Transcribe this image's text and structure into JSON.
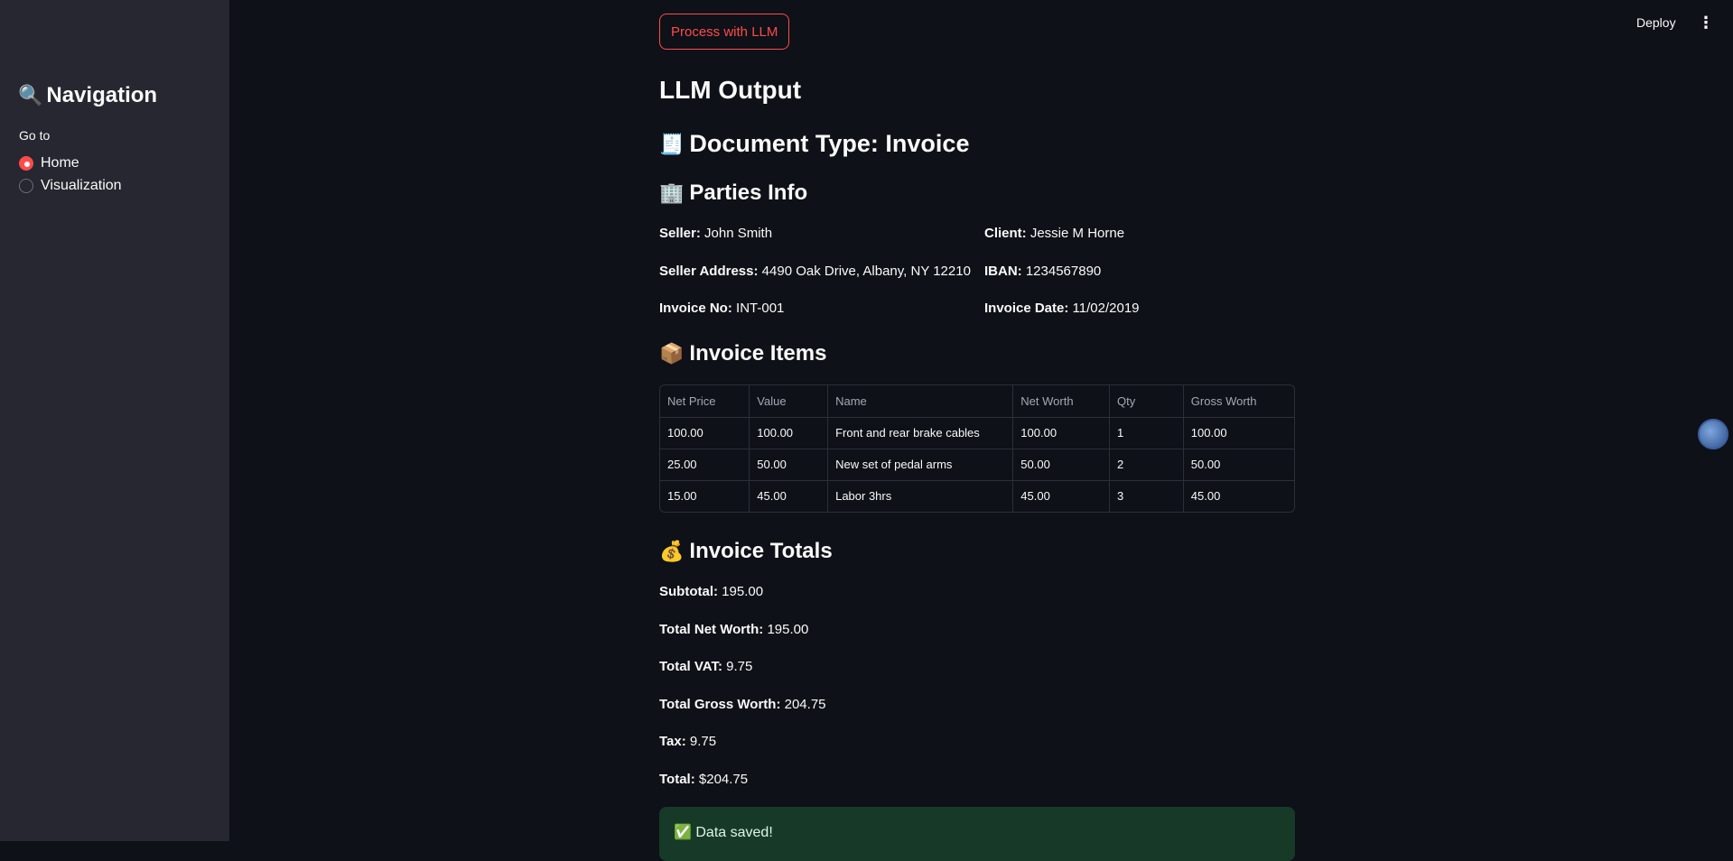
{
  "sidebar": {
    "title": "Navigation",
    "title_icon": "magnifier-icon",
    "goto_label": "Go to",
    "options": [
      {
        "label": "Home",
        "selected": true
      },
      {
        "label": "Visualization",
        "selected": false
      }
    ]
  },
  "topbar": {
    "deploy_label": "Deploy",
    "menu_glyph": "⋮"
  },
  "main": {
    "process_button": "Process with LLM",
    "llm_output_heading": "LLM Output",
    "doc_type_heading": "Document Type: Invoice",
    "parties_heading": "Parties Info",
    "parties": {
      "seller_label": "Seller:",
      "seller_value": "John Smith",
      "client_label": "Client:",
      "client_value": "Jessie M Horne",
      "seller_address_label": "Seller Address:",
      "seller_address_value": "4490 Oak Drive, Albany, NY 12210",
      "iban_label": "IBAN:",
      "iban_value": "1234567890",
      "invoice_no_label": "Invoice No:",
      "invoice_no_value": "INT-001",
      "invoice_date_label": "Invoice Date:",
      "invoice_date_value": "11/02/2019"
    },
    "items_heading": "Invoice Items",
    "items_table": {
      "headers": [
        "Net Price",
        "Value",
        "Name",
        "Net Worth",
        "Qty",
        "Gross Worth"
      ],
      "rows": [
        [
          "100.00",
          "100.00",
          "Front and rear brake cables",
          "100.00",
          "1",
          "100.00"
        ],
        [
          "25.00",
          "50.00",
          "New set of pedal arms",
          "50.00",
          "2",
          "50.00"
        ],
        [
          "15.00",
          "45.00",
          "Labor 3hrs",
          "45.00",
          "3",
          "45.00"
        ]
      ]
    },
    "totals_heading": "Invoice Totals",
    "totals": {
      "subtotal_label": "Subtotal:",
      "subtotal_value": "195.00",
      "net_worth_label": "Total Net Worth:",
      "net_worth_value": "195.00",
      "vat_label": "Total VAT:",
      "vat_value": "9.75",
      "gross_worth_label": "Total Gross Worth:",
      "gross_worth_value": "204.75",
      "tax_label": "Tax:",
      "tax_value": "9.75",
      "total_label": "Total:",
      "total_value": "$204.75"
    },
    "success_message": "Data saved!"
  },
  "colors": {
    "accent": "#ff4b4b",
    "background": "#0e1117",
    "sidebar": "#262730",
    "success_bg": "#173928"
  }
}
